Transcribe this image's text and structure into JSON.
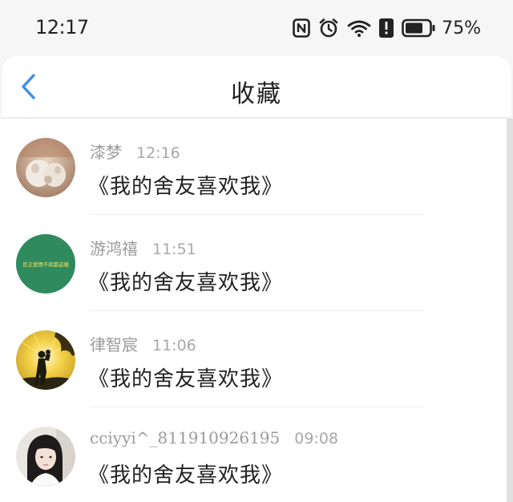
{
  "status_bar": {
    "time": "12:17",
    "icons": [
      "nfc-icon",
      "alarm-icon",
      "wifi-icon",
      "alert-icon",
      "battery-icon"
    ],
    "battery_percent": "75%"
  },
  "header": {
    "back_icon": "chevron-left-icon",
    "title": "收藏",
    "accent_color": "#3d8ee8"
  },
  "favorites": [
    {
      "sender": "漆梦",
      "time": "12:16",
      "message": "《我的舍友喜欢我》",
      "avatar": "plush-toy-photo"
    },
    {
      "sender": "游鸿禧",
      "time": "11:51",
      "message": "《我的舍友喜欢我》",
      "avatar": "green-banner",
      "avatar_text": "反正爱情不就都這樣"
    },
    {
      "sender": "律智宸",
      "time": "11:06",
      "message": "《我的舍友喜欢我》",
      "avatar": "silhouette-sunset-photo"
    },
    {
      "sender": "cciyyi^_811910926195",
      "time": "09:08",
      "message": "《我的舍友喜欢我》",
      "avatar": "girl-portrait-photo"
    }
  ]
}
